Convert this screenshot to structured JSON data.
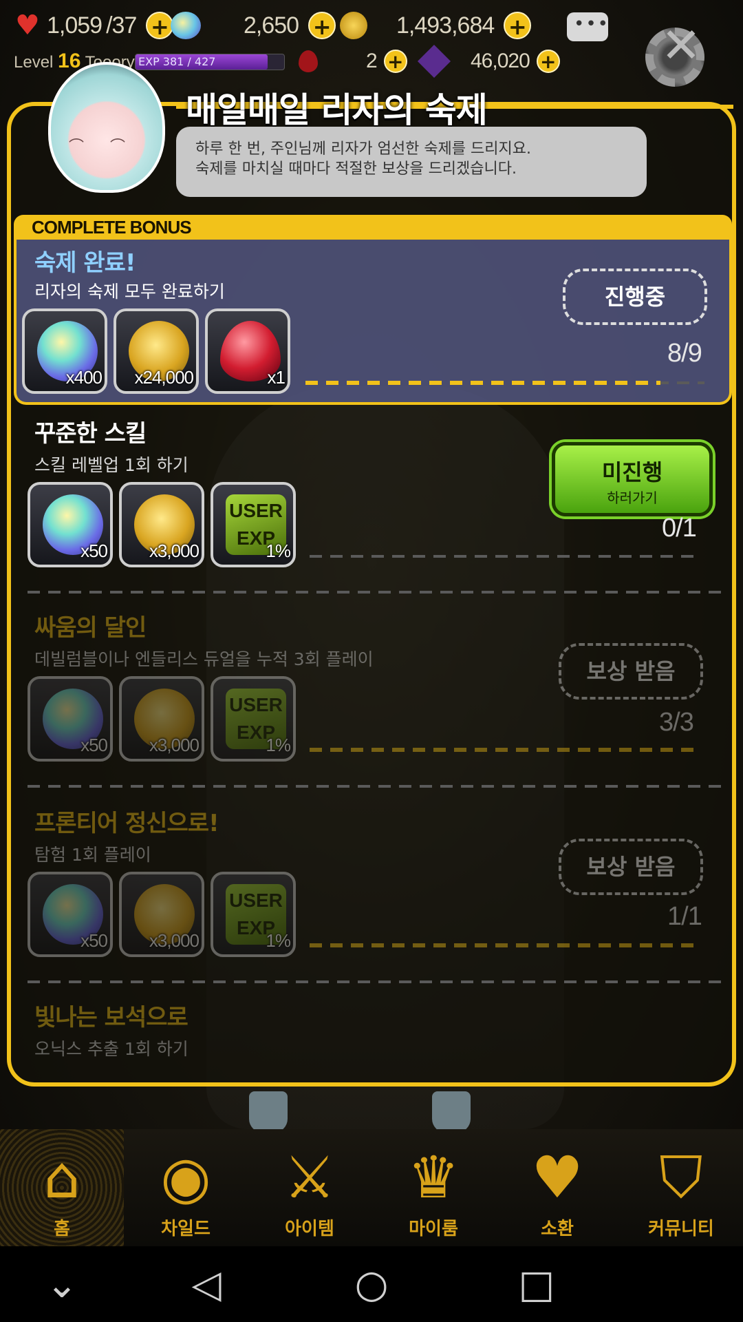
{
  "status_bar": {
    "hearts": "1,059",
    "hearts_max": "/37",
    "gems": "2,650",
    "gold": "1,493,684",
    "level_prefix": "Level",
    "level": "16",
    "username": "Tooory",
    "exp_text": "EXP 381 / 427",
    "exp_fraction": 0.89,
    "rubies": "2",
    "crystals": "46,020"
  },
  "modal": {
    "title": "매일매일 리자의 숙제",
    "speech_line1": "하루 한 번, 주인님께 리자가 엄선한 숙제를 드리지요.",
    "speech_line2": "숙제를 마치실 때마다 적절한 보상을 드리겠습니다.",
    "complete_bonus_label": "COMPLETE BONUS",
    "complete_bonus": {
      "title": "숙제 완료!",
      "desc": "리자의 숙제 모두 완료하기",
      "status": "진행중",
      "progress": "8/9",
      "progress_fraction": 0.889,
      "rewards": [
        {
          "icon": "gem",
          "qty": "x400"
        },
        {
          "icon": "gold-coins",
          "qty": "x24,000"
        },
        {
          "icon": "ruby",
          "qty": "x1"
        }
      ]
    },
    "quests": [
      {
        "title": "꾸준한 스킬",
        "desc": "스킬 레벨업 1회 하기",
        "button_line1": "미진행",
        "button_line2": "하러가기",
        "progress": "0/1",
        "rewards": [
          {
            "icon": "gem",
            "qty": "x50"
          },
          {
            "icon": "gold-coins",
            "qty": "x3,000"
          },
          {
            "icon": "user-exp",
            "label": "USER EXP",
            "qty": "1%"
          }
        ]
      },
      {
        "title": "싸움의 달인",
        "desc": "데빌럼블이나 엔들리스 듀얼을 누적 3회 플레이",
        "status": "보상 받음",
        "progress": "3/3",
        "rewards": [
          {
            "icon": "gem",
            "qty": "x50"
          },
          {
            "icon": "gold-coins",
            "qty": "x3,000"
          },
          {
            "icon": "user-exp",
            "label": "USER EXP",
            "qty": "1%"
          }
        ]
      },
      {
        "title": "프론티어 정신으로!",
        "desc": "탐험 1회 플레이",
        "status": "보상 받음",
        "progress": "1/1",
        "rewards": [
          {
            "icon": "gem",
            "qty": "x50"
          },
          {
            "icon": "gold-coins",
            "qty": "x3,000"
          },
          {
            "icon": "user-exp",
            "label": "USER EXP",
            "qty": "1%"
          }
        ]
      },
      {
        "title": "빛나는 보석으로",
        "desc": "오닉스 추출 1회 하기"
      }
    ]
  },
  "bottom_nav": [
    {
      "label": "홈",
      "icon": "home-arch-icon",
      "active": true
    },
    {
      "label": "차일드",
      "icon": "child-flame-icon"
    },
    {
      "label": "아이템",
      "icon": "item-sword-icon"
    },
    {
      "label": "마이룸",
      "icon": "myroom-crown-icon"
    },
    {
      "label": "소환",
      "icon": "summon-potion-icon"
    },
    {
      "label": "커뮤니티",
      "icon": "community-shield-icon"
    }
  ],
  "colors": {
    "accent": "#f2c21a",
    "panel": "#525680",
    "go_button": "#6ccc1a"
  }
}
